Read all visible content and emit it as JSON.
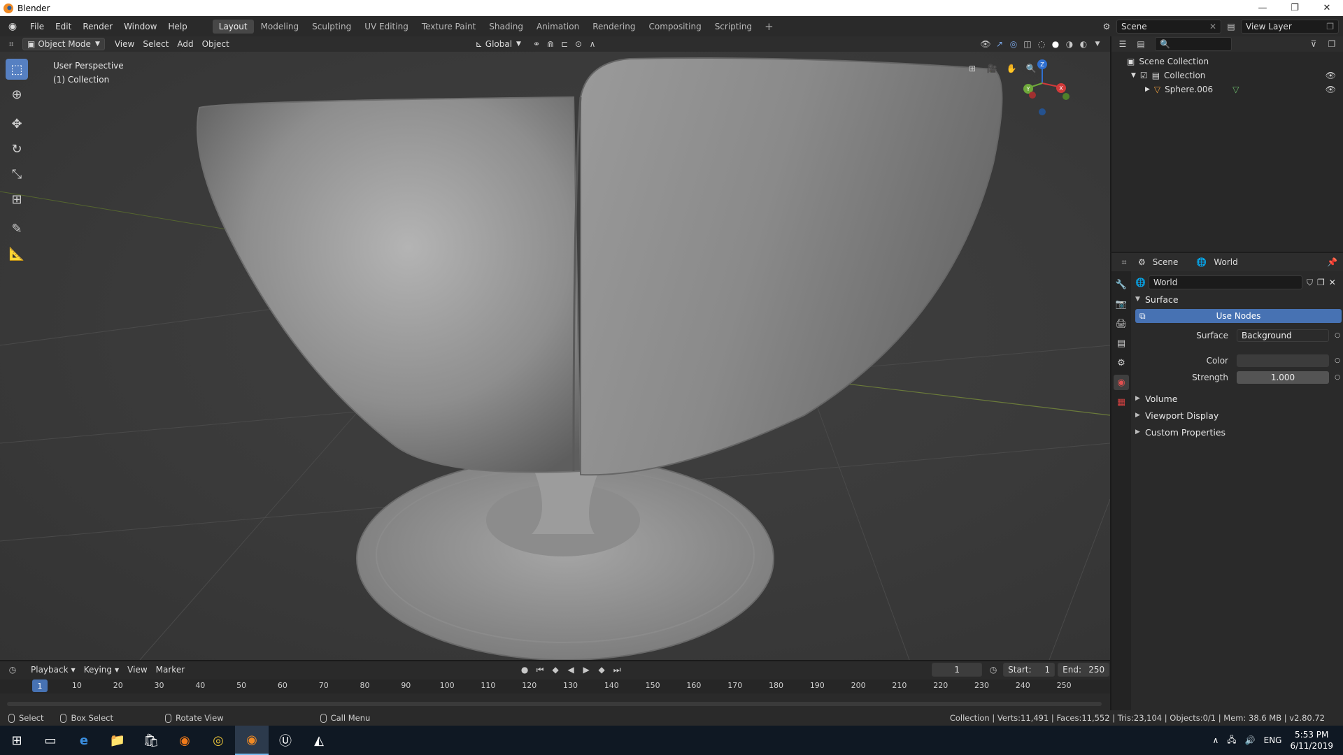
{
  "window": {
    "title": "Blender",
    "controls": [
      "—",
      "❐",
      "✕"
    ]
  },
  "menu": [
    "File",
    "Edit",
    "Render",
    "Window",
    "Help"
  ],
  "workspaces": [
    {
      "label": "Layout",
      "active": true
    },
    {
      "label": "Modeling"
    },
    {
      "label": "Sculpting"
    },
    {
      "label": "UV Editing"
    },
    {
      "label": "Texture Paint"
    },
    {
      "label": "Shading"
    },
    {
      "label": "Animation"
    },
    {
      "label": "Rendering"
    },
    {
      "label": "Compositing"
    },
    {
      "label": "Scripting"
    }
  ],
  "workspace_add": "+",
  "scene_field": "Scene",
  "view_layer_field": "View Layer",
  "viewport_header": {
    "mode": "Object Mode",
    "menus": [
      "View",
      "Select",
      "Add",
      "Object"
    ],
    "orientation": "Global"
  },
  "viewport": {
    "perspective": "User Perspective",
    "collection": "(1) Collection",
    "gizmo": {
      "z": "Z",
      "y": "Y",
      "x": "X"
    }
  },
  "outliner": {
    "search_placeholder": "",
    "items": [
      {
        "label": "Scene Collection"
      },
      {
        "label": "Collection"
      },
      {
        "label": "Sphere.006"
      }
    ]
  },
  "properties": {
    "breadcrumb": [
      "Scene",
      "World"
    ],
    "world_name": "World",
    "surface_panel": "Surface",
    "use_nodes": "Use Nodes",
    "surface_label": "Surface",
    "surface_value": "Background",
    "color_label": "Color",
    "strength_label": "Strength",
    "strength_value": "1.000",
    "collapsed_panels": [
      "Volume",
      "Viewport Display",
      "Custom Properties"
    ]
  },
  "timeline": {
    "menus": [
      "Playback",
      "Keying",
      "View",
      "Marker"
    ],
    "current_frame": "1",
    "start_label": "Start:",
    "start_value": "1",
    "end_label": "End:",
    "end_value": "250",
    "ruler_ticks": [
      "1",
      "10",
      "20",
      "30",
      "40",
      "50",
      "60",
      "70",
      "80",
      "90",
      "100",
      "110",
      "120",
      "130",
      "140",
      "150",
      "160",
      "170",
      "180",
      "190",
      "200",
      "210",
      "220",
      "230",
      "240",
      "250"
    ]
  },
  "statusbar": {
    "select": "Select",
    "box_select": "Box Select",
    "rotate_view": "Rotate View",
    "call_menu": "Call Menu",
    "stats": "Collection | Verts:11,491 | Faces:11,552 | Tris:23,104 | Objects:0/1 | Mem: 38.6 MB | v2.80.72"
  },
  "taskbar": {
    "language": "ENG",
    "time": "5:53 PM",
    "date": "6/11/2019"
  },
  "colors": {
    "accent": "#4772b3",
    "active_tool": "#5680c2"
  }
}
